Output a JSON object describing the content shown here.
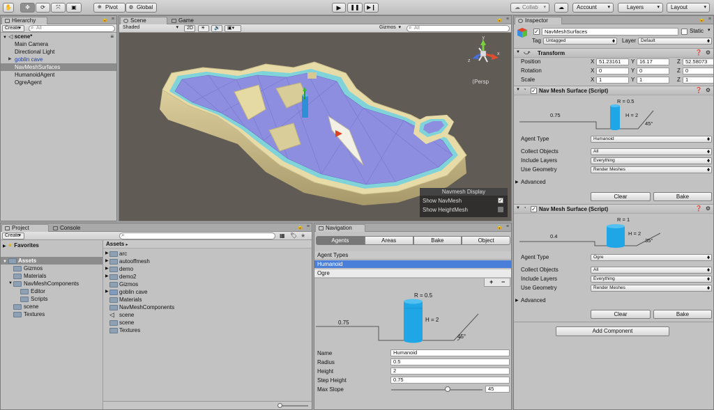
{
  "toolbar": {
    "pivot": "Pivot",
    "global": "Global",
    "collab": "Collab",
    "account": "Account",
    "layers": "Layers",
    "layout": "Layout"
  },
  "hierarchy": {
    "tab": "Hierarchy",
    "create": "Create",
    "search_placeholder": "All",
    "scene": "scene*",
    "items": [
      "Main Camera",
      "Directional Light",
      "goblin cave",
      "NavMeshSurfaces",
      "HumanoidAgent",
      "OgreAgent"
    ]
  },
  "scene_view": {
    "tab_scene": "Scene",
    "tab_game": "Game",
    "shading": "Shaded",
    "mode_2d": "2D",
    "gizmos": "Gizmos",
    "search_placeholder": "All",
    "persp": "Persp",
    "gizmo_y": "y",
    "gizmo_x": "x",
    "gizmo_z": "z",
    "navmesh_display": {
      "title": "Navmesh Display",
      "show_navmesh": "Show NavMesh",
      "show_heightmesh": "Show HeightMesh",
      "navmesh_checked": true,
      "heightmesh_checked": false
    }
  },
  "project": {
    "tab_project": "Project",
    "tab_console": "Console",
    "create": "Create",
    "favorites": "Favorites",
    "assets": "Assets",
    "tree": [
      "Gizmos",
      "Materials",
      "NavMeshComponents",
      "Editor",
      "Scripts",
      "scene",
      "Textures"
    ],
    "breadcrumb": "Assets",
    "files": [
      "arc",
      "autooffmesh",
      "demo",
      "demo2",
      "Gizmos",
      "goblin cave",
      "Materials",
      "NavMeshComponents",
      "scene",
      "scene",
      "Textures"
    ]
  },
  "navigation": {
    "tab": "Navigation",
    "tabs": [
      "Agents",
      "Areas",
      "Bake",
      "Object"
    ],
    "agent_types_label": "Agent Types",
    "agents": [
      "Humanoid",
      "Ogre"
    ],
    "add": "+",
    "remove": "−",
    "diagram": {
      "r": "R = 0.5",
      "h": "H = 2",
      "step": "0.75",
      "slope": "45°"
    },
    "fields": {
      "name_label": "Name",
      "name": "Humanoid",
      "radius_label": "Radius",
      "radius": "0.5",
      "height_label": "Height",
      "height": "2",
      "step_label": "Step Height",
      "step": "0.75",
      "slope_label": "Max Slope",
      "slope": "45"
    },
    "slope_fraction": 0.62
  },
  "inspector": {
    "tab": "Inspector",
    "object_name": "NavMeshSurfaces",
    "static": "Static",
    "tag_label": "Tag",
    "tag": "Untagged",
    "layer_label": "Layer",
    "layer": "Default",
    "transform": {
      "title": "Transform",
      "position_label": "Position",
      "rotation_label": "Rotation",
      "scale_label": "Scale",
      "position": [
        "51.23161",
        "16.17",
        "52.58073"
      ],
      "rotation": [
        "0",
        "0",
        "0"
      ],
      "scale": [
        "1",
        "1",
        "1"
      ],
      "axis": [
        "X",
        "Y",
        "Z"
      ]
    },
    "surface1": {
      "title": "Nav Mesh Surface (Script)",
      "r": "R = 0.5",
      "h": "H = 2",
      "step": "0.75",
      "slope": "45°",
      "agent_type_label": "Agent Type",
      "agent_type": "Humanoid",
      "collect_label": "Collect Objects",
      "collect": "All",
      "include_label": "Include Layers",
      "include": "Everything",
      "geometry_label": "Use Geometry",
      "geometry": "Render Meshes",
      "advanced": "Advanced",
      "clear": "Clear",
      "bake": "Bake"
    },
    "surface2": {
      "title": "Nav Mesh Surface (Script)",
      "r": "R = 1",
      "h": "H = 2",
      "step": "0.4",
      "slope": "35°",
      "agent_type_label": "Agent Type",
      "agent_type": "Ogre",
      "collect_label": "Collect Objects",
      "collect": "All",
      "include_label": "Include Layers",
      "include": "Everything",
      "geometry_label": "Use Geometry",
      "geometry": "Render Meshes",
      "advanced": "Advanced",
      "clear": "Clear",
      "bake": "Bake"
    },
    "add_component": "Add Component"
  }
}
